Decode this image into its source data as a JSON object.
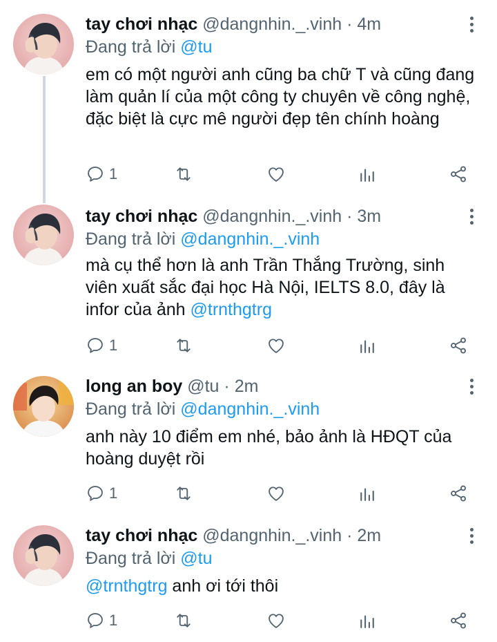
{
  "reply_prefix": "Đang trả lời",
  "tweets": [
    {
      "name": "tay chơi nhạc",
      "handle": "@dangnhin._.vinh",
      "sep": "·",
      "time": "4m",
      "replying_to": "@tu",
      "body": "em có một người anh cũng ba chữ T và cũng đang làm quản lí của một công ty chuyên về công nghệ, đặc biệt là cực mê người đẹp tên chính hoàng",
      "reply_count": "1",
      "avatar": "avatar-a"
    },
    {
      "name": "tay chơi nhạc",
      "handle": "@dangnhin._.vinh",
      "sep": "·",
      "time": "3m",
      "replying_to": "@dangnhin._.vinh",
      "body_before": "mà cụ thể hơn là anh Trần Thắng Trường, sinh viên xuất sắc đại học Hà Nội, IELTS 8.0, đây là infor của ảnh ",
      "body_mention": "@trnthgtrg",
      "reply_count": "1",
      "avatar": "avatar-a"
    },
    {
      "name": "long an boy",
      "handle": "@tu",
      "sep": "·",
      "time": "2m",
      "replying_to": "@dangnhin._.vinh",
      "body": "anh này 10 điểm em nhé, bảo ảnh là HĐQT của hoàng duyệt rồi",
      "reply_count": "1",
      "avatar": "avatar-b"
    },
    {
      "name": "tay chơi nhạc",
      "handle": "@dangnhin._.vinh",
      "sep": "·",
      "time": "2m",
      "replying_to": "@tu",
      "body_mention": "@trnthgtrg",
      "body_after": " anh ơi tới thôi",
      "reply_count": "1",
      "avatar": "avatar-a"
    }
  ],
  "icons": {
    "reply": "reply-icon",
    "retweet": "retweet-icon",
    "like": "like-icon",
    "analytics": "analytics-icon",
    "share": "share-icon",
    "more": "more-vertical-icon"
  },
  "colors": {
    "link": "#1d9bf0",
    "secondary": "#536471",
    "thread_line": "#cfd9de"
  }
}
